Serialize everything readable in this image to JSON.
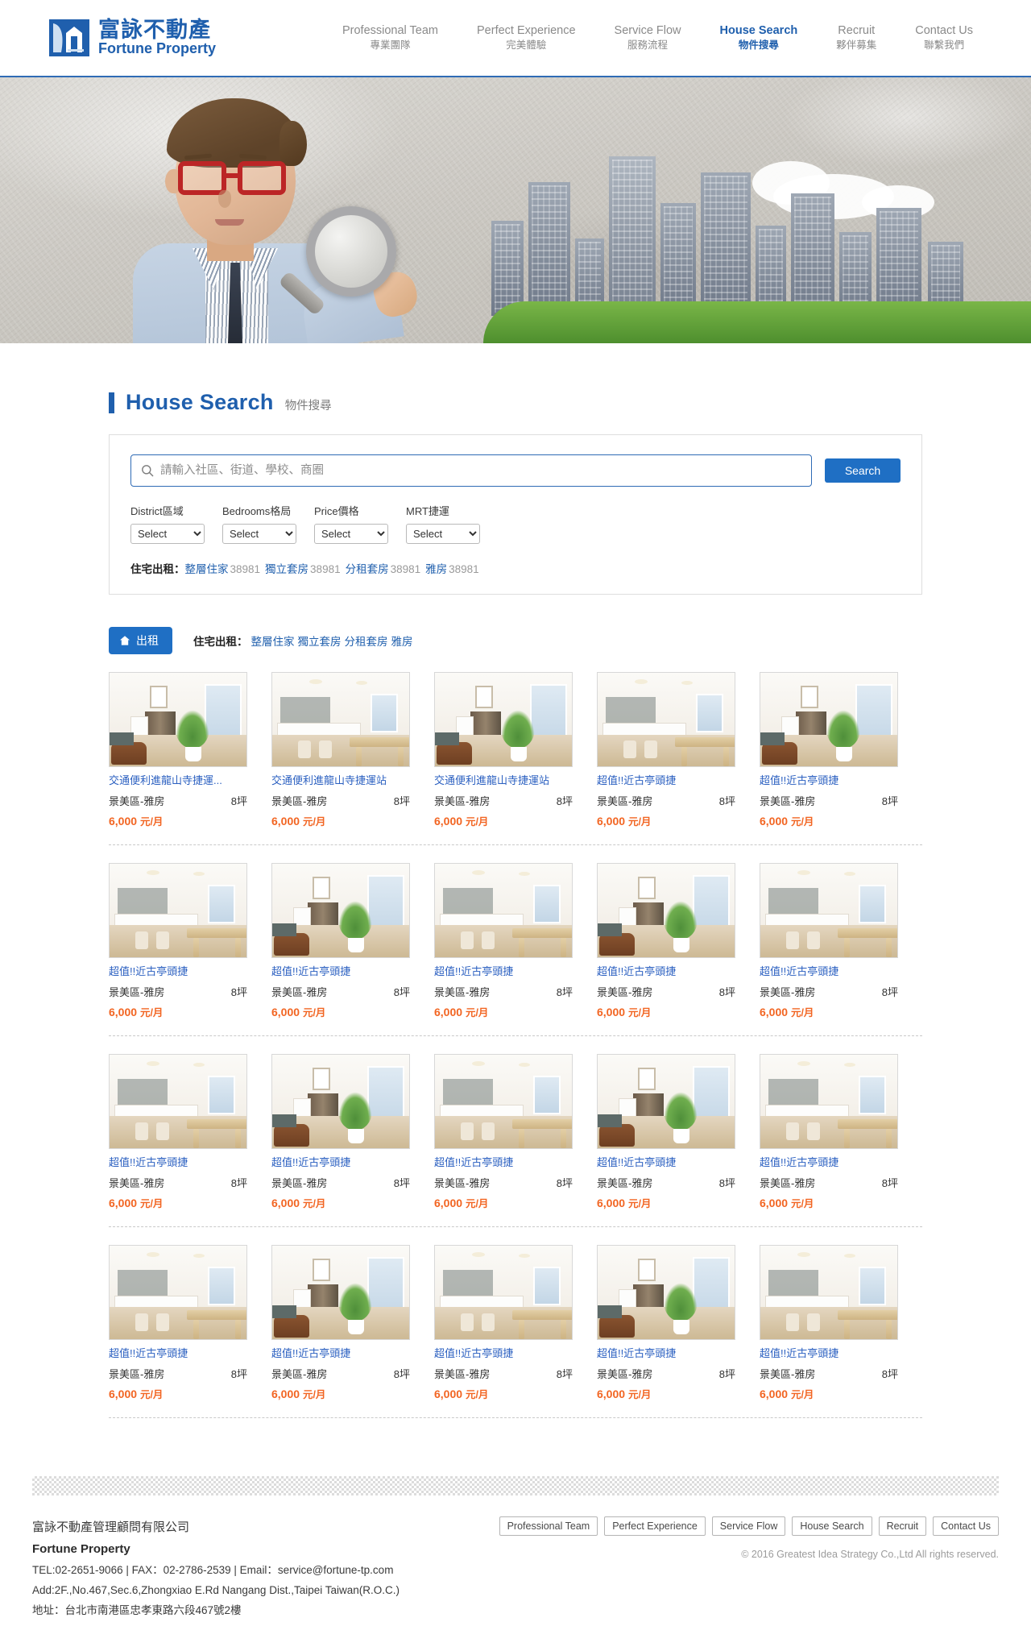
{
  "brand": {
    "name_cn": "富詠不動產",
    "name_en": "Fortune Property",
    "logo_icon": "fortune-property-logo"
  },
  "nav": {
    "items": [
      {
        "en": "Professional Team",
        "cn": "專業團隊",
        "active": false
      },
      {
        "en": "Perfect Experience",
        "cn": "完美體驗",
        "active": false
      },
      {
        "en": "Service Flow",
        "cn": "服務流程",
        "active": false
      },
      {
        "en": "House Search",
        "cn": "物件搜尋",
        "active": true
      },
      {
        "en": "Recruit",
        "cn": "夥伴募集",
        "active": false
      },
      {
        "en": "Contact Us",
        "cn": "聯繫我們",
        "active": false
      }
    ]
  },
  "hero": {
    "alt": "boy-with-magnifying-glass-and-city-skyline-banner"
  },
  "page": {
    "title_en": "House Search",
    "title_cn": "物件搜尋"
  },
  "search": {
    "placeholder": "請輸入社區、街道、學校、商圈",
    "value": "",
    "button_label": "Search",
    "search_icon": "search-icon"
  },
  "filters": [
    {
      "label": "District區域",
      "value": "Select"
    },
    {
      "label": "Bedrooms格局",
      "value": "Select"
    },
    {
      "label": "Price價格",
      "value": "Select"
    },
    {
      "label": "MRT捷運",
      "value": "Select"
    }
  ],
  "category_summary": {
    "heading": "住宅出租：",
    "items": [
      {
        "label": "整層住家",
        "count": "38981"
      },
      {
        "label": "獨立套房",
        "count": "38981"
      },
      {
        "label": "分租套房",
        "count": "38981"
      },
      {
        "label": "雅房",
        "count": "38981"
      }
    ]
  },
  "result_bar": {
    "tab_label": "出租",
    "tab_icon": "home-icon",
    "sub_heading": "住宅出租：",
    "sub_items": [
      "整層住家",
      "獨立套房",
      "分租套房",
      "雅房"
    ]
  },
  "listings": {
    "price_unit": "元/月",
    "rows": [
      [
        {
          "title": "交通便利進龍山寺捷運...",
          "district": "景美區-雅房",
          "size": "8坪",
          "price": "6,000",
          "thumb": "room-closet-sofa"
        },
        {
          "title": "交通便利進龍山寺捷運站",
          "district": "景美區-雅房",
          "size": "8坪",
          "price": "6,000",
          "thumb": "room-kitchen-bar"
        },
        {
          "title": "交通便利進龍山寺捷運站",
          "district": "景美區-雅房",
          "size": "8坪",
          "price": "6,000",
          "thumb": "room-closet-sofa"
        },
        {
          "title": "超值!!近古亭頭捷",
          "district": "景美區-雅房",
          "size": "8坪",
          "price": "6,000",
          "thumb": "room-kitchen-bar"
        },
        {
          "title": "超值!!近古亭頭捷",
          "district": "景美區-雅房",
          "size": "8坪",
          "price": "6,000",
          "thumb": "room-closet-sofa"
        }
      ],
      [
        {
          "title": "超值!!近古亭頭捷",
          "district": "景美區-雅房",
          "size": "8坪",
          "price": "6,000",
          "thumb": "room-kitchen-bar"
        },
        {
          "title": "超值!!近古亭頭捷",
          "district": "景美區-雅房",
          "size": "8坪",
          "price": "6,000",
          "thumb": "room-closet-sofa"
        },
        {
          "title": "超值!!近古亭頭捷",
          "district": "景美區-雅房",
          "size": "8坪",
          "price": "6,000",
          "thumb": "room-kitchen-bar"
        },
        {
          "title": "超值!!近古亭頭捷",
          "district": "景美區-雅房",
          "size": "8坪",
          "price": "6,000",
          "thumb": "room-closet-sofa"
        },
        {
          "title": "超值!!近古亭頭捷",
          "district": "景美區-雅房",
          "size": "8坪",
          "price": "6,000",
          "thumb": "room-kitchen-bar"
        }
      ],
      [
        {
          "title": "超值!!近古亭頭捷",
          "district": "景美區-雅房",
          "size": "8坪",
          "price": "6,000",
          "thumb": "room-kitchen-bar"
        },
        {
          "title": "超值!!近古亭頭捷",
          "district": "景美區-雅房",
          "size": "8坪",
          "price": "6,000",
          "thumb": "room-closet-sofa"
        },
        {
          "title": "超值!!近古亭頭捷",
          "district": "景美區-雅房",
          "size": "8坪",
          "price": "6,000",
          "thumb": "room-kitchen-bar"
        },
        {
          "title": "超值!!近古亭頭捷",
          "district": "景美區-雅房",
          "size": "8坪",
          "price": "6,000",
          "thumb": "room-closet-sofa"
        },
        {
          "title": "超值!!近古亭頭捷",
          "district": "景美區-雅房",
          "size": "8坪",
          "price": "6,000",
          "thumb": "room-kitchen-bar"
        }
      ],
      [
        {
          "title": "超值!!近古亭頭捷",
          "district": "景美區-雅房",
          "size": "8坪",
          "price": "6,000",
          "thumb": "room-kitchen-bar"
        },
        {
          "title": "超值!!近古亭頭捷",
          "district": "景美區-雅房",
          "size": "8坪",
          "price": "6,000",
          "thumb": "room-closet-sofa"
        },
        {
          "title": "超值!!近古亭頭捷",
          "district": "景美區-雅房",
          "size": "8坪",
          "price": "6,000",
          "thumb": "room-kitchen-bar"
        },
        {
          "title": "超值!!近古亭頭捷",
          "district": "景美區-雅房",
          "size": "8坪",
          "price": "6,000",
          "thumb": "room-closet-sofa"
        },
        {
          "title": "超值!!近古亭頭捷",
          "district": "景美區-雅房",
          "size": "8坪",
          "price": "6,000",
          "thumb": "room-kitchen-bar"
        }
      ]
    ]
  },
  "footer": {
    "company_cn": "富詠不動產管理顧問有限公司",
    "company_en": "Fortune Property",
    "contact": "TEL:02-2651-9066 | FAX：02-2786-2539 | Email：service@fortune-tp.com",
    "address_en": "Add:2F.,No.467,Sec.6,Zhongxiao E.Rd Nangang Dist.,Taipei Taiwan(R.O.C.)",
    "address_cn": "地址：台北市南港區忠孝東路六段467號2樓",
    "nav": [
      "Professional Team",
      "Perfect Experience",
      "Service Flow",
      "House Search",
      "Recruit",
      "Contact Us"
    ],
    "copyright": "© 2016 Greatest Idea Strategy Co.,Ltd All rights reserved."
  },
  "colors": {
    "brand_blue": "#1f5fad",
    "button_blue": "#1f6fc4",
    "price_orange": "#f26522",
    "link_blue": "#2a5fc0"
  }
}
